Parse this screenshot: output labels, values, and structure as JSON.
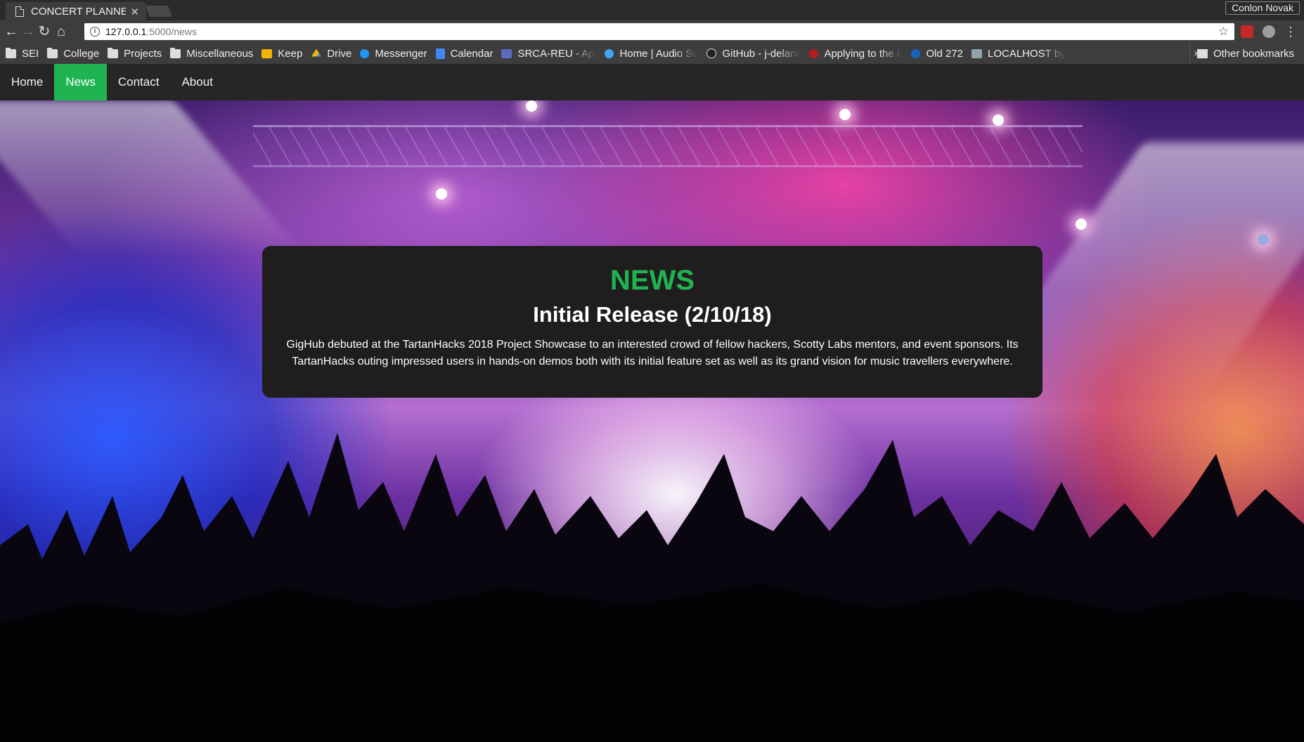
{
  "browser": {
    "tab_title": "CONCERT PLANNER",
    "profile_name": "Conlon Novak",
    "url_host": "127.0.0.1",
    "url_path": ":5000/news",
    "bookmarks": [
      {
        "label": "SEI",
        "icon": "folder-icon"
      },
      {
        "label": "College",
        "icon": "folder-icon"
      },
      {
        "label": "Projects",
        "icon": "folder-icon"
      },
      {
        "label": "Miscellaneous",
        "icon": "folder-icon"
      },
      {
        "label": "Keep",
        "icon": "keep-icon"
      },
      {
        "label": "Drive",
        "icon": "drive-icon"
      },
      {
        "label": "Messenger",
        "icon": "messenger-icon"
      },
      {
        "label": "Calendar",
        "icon": "calendar-icon"
      },
      {
        "label": "SRCA-REU - Appl",
        "icon": "form-icon"
      },
      {
        "label": "Home | Audio Sw",
        "icon": "globe-icon"
      },
      {
        "label": "GitHub - j-delane",
        "icon": "github-icon"
      },
      {
        "label": "Applying to the U",
        "icon": "red-dot-icon"
      },
      {
        "label": "Old 272",
        "icon": "globe-icon"
      },
      {
        "label": "LOCALHOST by A",
        "icon": "image-icon"
      }
    ],
    "more_bookmarks": "»",
    "other_bookmarks": "Other bookmarks"
  },
  "nav": {
    "items": [
      {
        "label": "Home"
      },
      {
        "label": "News",
        "active": true
      },
      {
        "label": "Contact"
      },
      {
        "label": "About"
      }
    ]
  },
  "news": {
    "heading": "NEWS",
    "title": "Initial Release (2/10/18)",
    "body": "GigHub debuted at the TartanHacks 2018 Project Showcase to an interested crowd of fellow hackers, Scotty Labs mentors, and event sponsors. Its TartanHacks outing impressed users in hands-on demos both with its initial feature set as well as its grand vision for music travellers everywhere."
  },
  "colors": {
    "accent": "#1fb451",
    "navbar": "#262626",
    "card": "#1f1d1d"
  }
}
